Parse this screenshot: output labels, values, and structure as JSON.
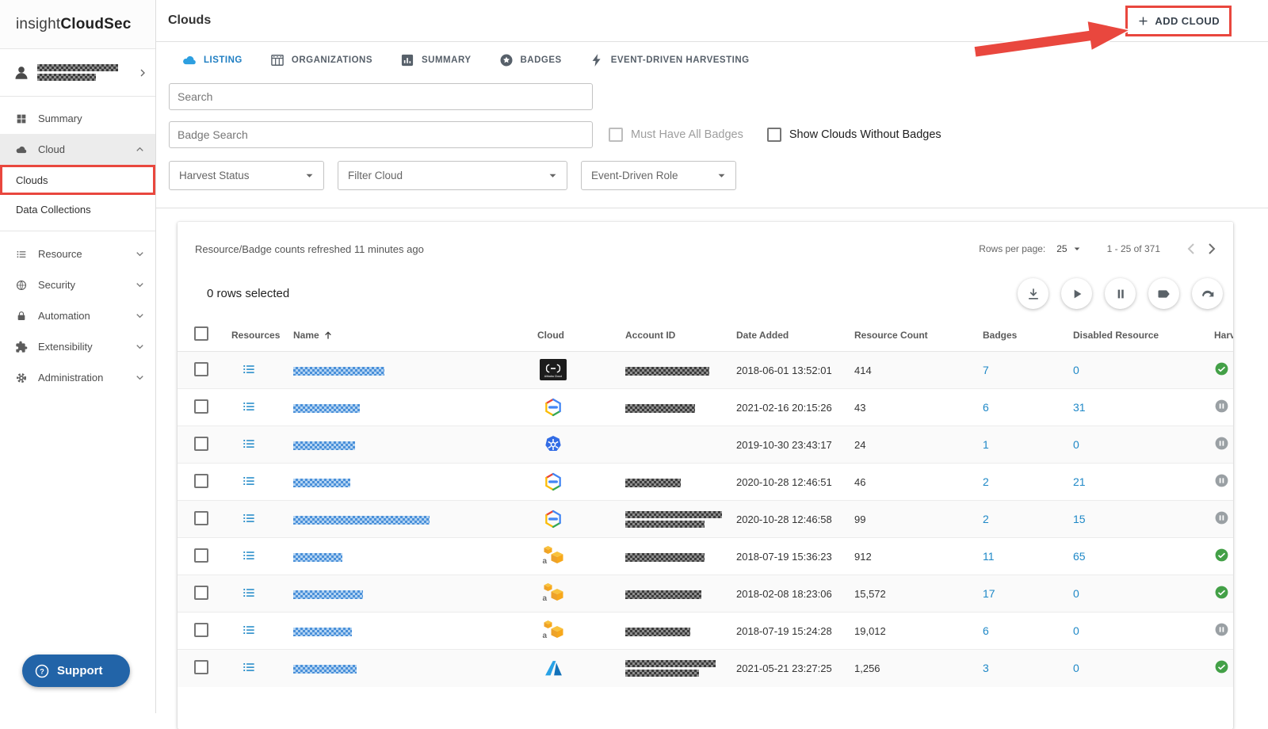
{
  "app": {
    "logo_regular": "insight",
    "logo_bold": "CloudSec"
  },
  "colors": {
    "annotation_red": "#e9473e",
    "link_blue": "#1e88c7",
    "harvest_active_green": "#43a047",
    "harvest_paused_grey": "#9aa0a4",
    "support_blue": "#2264a8",
    "tab_active_blue": "#1f7ec2"
  },
  "sidebar": {
    "user": {
      "redacted": true
    },
    "items": [
      {
        "id": "summary",
        "label": "Summary",
        "icon": "grid"
      },
      {
        "id": "cloud",
        "label": "Cloud",
        "icon": "cloud",
        "active": true,
        "chevron": "up",
        "separator_after": true,
        "children": [
          {
            "id": "clouds",
            "label": "Clouds",
            "annotated": true
          },
          {
            "id": "data-collections",
            "label": "Data Collections"
          }
        ]
      },
      {
        "id": "resource",
        "label": "Resource",
        "icon": "list",
        "chevron": "down"
      },
      {
        "id": "security",
        "label": "Security",
        "icon": "globe",
        "chevron": "down"
      },
      {
        "id": "automation",
        "label": "Automation",
        "icon": "lock",
        "chevron": "down"
      },
      {
        "id": "extensibility",
        "label": "Extensibility",
        "icon": "puzzle",
        "chevron": "down"
      },
      {
        "id": "administration",
        "label": "Administration",
        "icon": "gear",
        "chevron": "down"
      }
    ],
    "support_label": "Support"
  },
  "header": {
    "title": "Clouds",
    "add_button_label": "ADD CLOUD"
  },
  "tabs": [
    {
      "id": "listing",
      "label": "LISTING",
      "icon": "cloud",
      "active": true
    },
    {
      "id": "organizations",
      "label": "ORGANIZATIONS",
      "icon": "org"
    },
    {
      "id": "summary",
      "label": "SUMMARY",
      "icon": "chart"
    },
    {
      "id": "badges",
      "label": "BADGES",
      "icon": "badge-star"
    },
    {
      "id": "event-driven-harvesting",
      "label": "EVENT-DRIVEN HARVESTING",
      "icon": "bolt"
    }
  ],
  "filters": {
    "search_placeholder": "Search",
    "badge_search_placeholder": "Badge Search",
    "must_have_label": "Must Have All Badges",
    "show_without_label": "Show Clouds Without Badges",
    "dropdowns": [
      {
        "id": "harvest-status",
        "label": "Harvest Status"
      },
      {
        "id": "filter-cloud",
        "label": "Filter Cloud"
      },
      {
        "id": "event-driven-role",
        "label": "Event-Driven Role"
      }
    ]
  },
  "icons": {
    "alibaba_label": "Alibaba Cloud"
  },
  "table": {
    "refresh_note": "Resource/Badge counts refreshed 11 minutes ago",
    "rows_per_page_label": "Rows per page:",
    "rows_per_page_value": "25",
    "range_label": "1 - 25 of 371",
    "selected_label": "0 rows selected",
    "columns": [
      "Resources",
      "Name",
      "Cloud",
      "Account ID",
      "Date Added",
      "Resource Count",
      "Badges",
      "Disabled Resource",
      "Harvest"
    ],
    "actions": [
      "download",
      "play",
      "pause",
      "label",
      "redo"
    ],
    "rows": [
      {
        "cloud": "alibaba",
        "date_added": "2018-06-01 13:52:01",
        "resource_count": "414",
        "badges": "7",
        "disabled_resources": "0",
        "harvest": "active",
        "name_redaction_width": 115,
        "account_redaction_width": 106,
        "account_lines": 1
      },
      {
        "cloud": "gcp",
        "date_added": "2021-02-16 20:15:26",
        "resource_count": "43",
        "badges": "6",
        "disabled_resources": "31",
        "harvest": "paused",
        "name_redaction_width": 84,
        "account_redaction_width": 88,
        "account_lines": 1
      },
      {
        "cloud": "kubernetes",
        "date_added": "2019-10-30 23:43:17",
        "resource_count": "24",
        "badges": "1",
        "disabled_resources": "0",
        "harvest": "paused",
        "name_redaction_width": 78,
        "account_redaction_width": 0,
        "account_lines": 0
      },
      {
        "cloud": "gcp",
        "date_added": "2020-10-28 12:46:51",
        "resource_count": "46",
        "badges": "2",
        "disabled_resources": "21",
        "harvest": "paused",
        "name_redaction_width": 72,
        "account_redaction_width": 70,
        "account_lines": 1
      },
      {
        "cloud": "gcp",
        "date_added": "2020-10-28 12:46:58",
        "resource_count": "99",
        "badges": "2",
        "disabled_resources": "15",
        "harvest": "paused",
        "name_redaction_width": 172,
        "account_redaction_width": 122,
        "account_lines": 2
      },
      {
        "cloud": "aws",
        "date_added": "2018-07-19 15:36:23",
        "resource_count": "912",
        "badges": "11",
        "disabled_resources": "65",
        "harvest": "active",
        "name_redaction_width": 62,
        "account_redaction_width": 100,
        "account_lines": 1
      },
      {
        "cloud": "aws",
        "date_added": "2018-02-08 18:23:06",
        "resource_count": "15,572",
        "badges": "17",
        "disabled_resources": "0",
        "harvest": "active",
        "name_redaction_width": 88,
        "account_redaction_width": 96,
        "account_lines": 1
      },
      {
        "cloud": "aws",
        "date_added": "2018-07-19 15:24:28",
        "resource_count": "19,012",
        "badges": "6",
        "disabled_resources": "0",
        "harvest": "paused",
        "name_redaction_width": 74,
        "account_redaction_width": 82,
        "account_lines": 1
      },
      {
        "cloud": "azure",
        "date_added": "2021-05-21 23:27:25",
        "resource_count": "1,256",
        "badges": "3",
        "disabled_resources": "0",
        "harvest": "active",
        "name_redaction_width": 80,
        "account_redaction_width": 114,
        "account_lines": 2
      }
    ]
  }
}
